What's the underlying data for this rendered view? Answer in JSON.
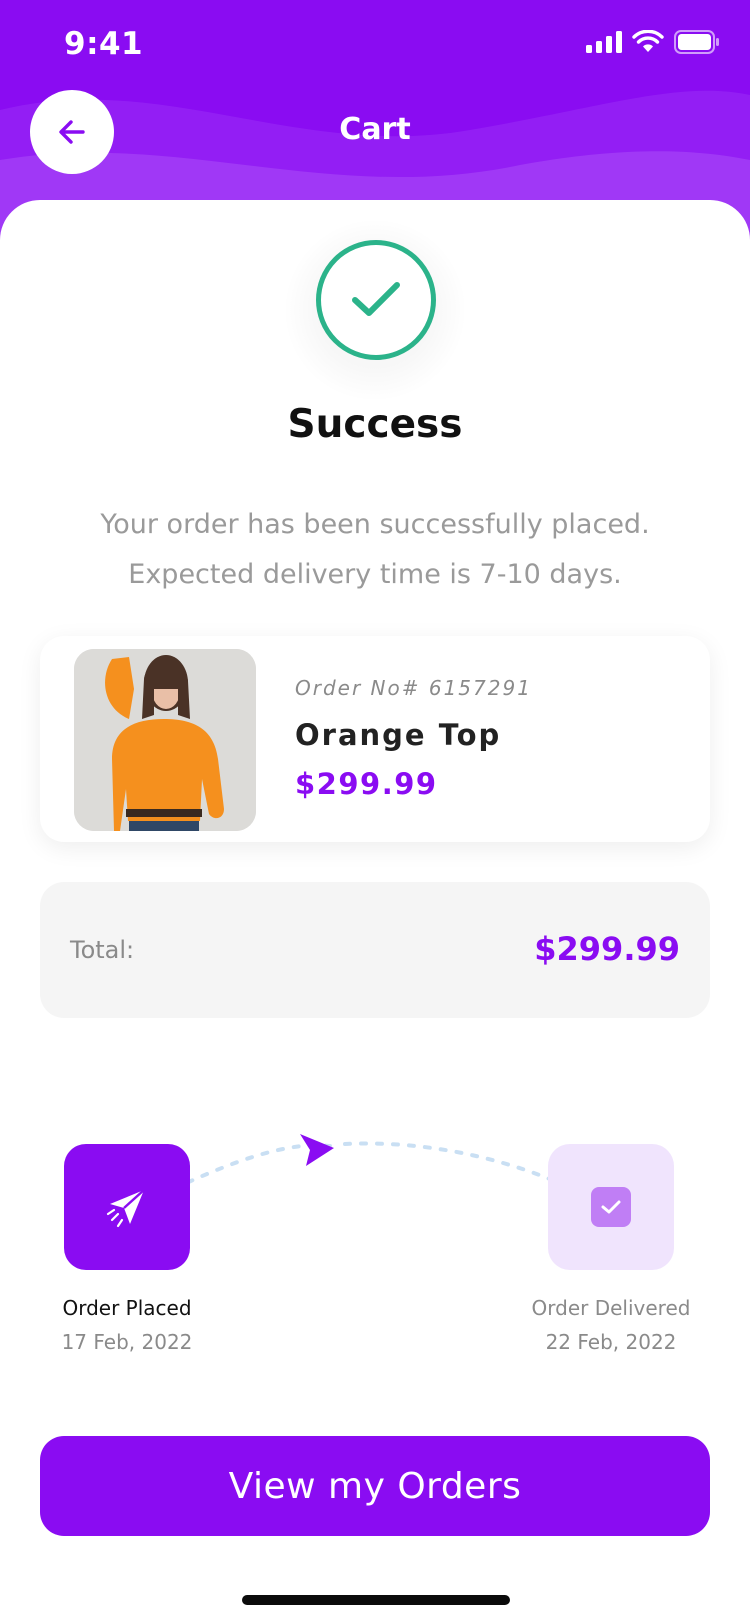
{
  "status_bar": {
    "time": "9:41"
  },
  "header": {
    "title": "Cart"
  },
  "success": {
    "title": "Success",
    "message_line1": "Your order has been successfully placed.",
    "message_line2": "Expected delivery time is 7-10 days."
  },
  "product": {
    "order_no": "Order No# 6157291",
    "name": "Orange Top",
    "price": "$299.99"
  },
  "total": {
    "label": "Total:",
    "value": "$299.99"
  },
  "tracking": {
    "placed_label": "Order Placed",
    "placed_date": "17 Feb, 2022",
    "delivered_label": "Order Delivered",
    "delivered_date": "22 Feb, 2022"
  },
  "cta": {
    "label": "View my Orders"
  },
  "colors": {
    "accent": "#8a0cf2",
    "success": "#2bb38a",
    "muted": "#9a9a9a"
  }
}
